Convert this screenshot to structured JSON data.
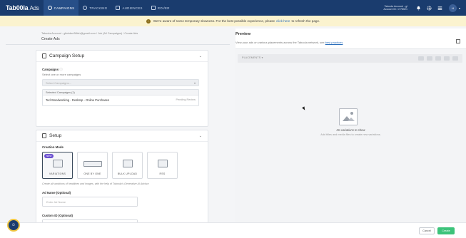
{
  "nav": {
    "logo": "Tab00la",
    "logo_suffix": "Ads",
    "tabs": [
      {
        "label": "CAMPAIGNS",
        "icon": "megaphone-icon"
      },
      {
        "label": "TRACKING",
        "icon": "tracking-icon"
      },
      {
        "label": "AUDIENCES",
        "icon": "audiences-icon"
      },
      {
        "label": "ROI/ER",
        "icon": "chart-icon"
      }
    ],
    "account_line1": "Taboola Account - gl",
    "account_line2": "Account ID: 1778521",
    "avatar": "Н"
  },
  "banner": {
    "text_before": "We're aware of some temporary slowness. For the best possible experience, please",
    "link": "click here",
    "text_after": "to refresh the page."
  },
  "left": {
    "breadcrumb": "Taboola Account - glinkdee38leh@gmail.com / Job (All Campaigns) / Create Ads",
    "title": "Create Ads",
    "campaign_setup": {
      "title": "Campaign Setup",
      "campaigns_label": "Campaigns",
      "campaigns_sub": "Select one or more campaigns",
      "placeholder": "Select Campaigns...",
      "selected_header": "Selected Campaigns (1)",
      "selected_name": "Ted Woodworking - Desktop - Online Purchases",
      "selected_status": "Pending Review"
    },
    "setup": {
      "title": "Setup",
      "creation_mode_label": "Creation Mode",
      "modes": [
        {
          "label": "VARIATIONS",
          "badge": "NEW"
        },
        {
          "label": "ONE BY ONE"
        },
        {
          "label": "BULK UPLOAD"
        },
        {
          "label": "RSS"
        }
      ],
      "help": "Create all variations of headlines and images, with the help of Taboola's Generative AI Advisor",
      "ad_name_label": "Ad Name (Optional)",
      "ad_name_placeholder": "Enter Ad Name",
      "custom_id_label": "Custom ID (Optional)"
    }
  },
  "preview": {
    "title": "Preview",
    "sub_before": "View your ads on various placements across the Taboola network, see",
    "sub_link": "best practices",
    "placements": "PLACEMENTS",
    "empty_title": "No variations to show",
    "empty_sub": "Add titles and media files to create new variations."
  },
  "footer": {
    "cancel": "Cancel",
    "create": "Create"
  }
}
